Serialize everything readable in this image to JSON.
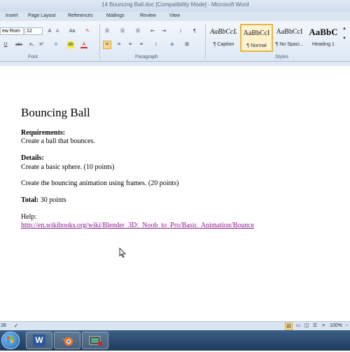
{
  "window": {
    "title": "14 Bouncing Ball.doc [Compatibility Mode] - Microsoft Word"
  },
  "tabs": [
    "Insert",
    "Page Layout",
    "References",
    "Mailings",
    "Review",
    "View"
  ],
  "ribbon": {
    "font_name": "ew Rom",
    "font_size": "12",
    "group_font": "Font",
    "group_paragraph": "Paragraph",
    "group_styles": "Styles",
    "styles": [
      {
        "sample": "AaBbCcL",
        "name": "¶ Caption"
      },
      {
        "sample": "AaBbCcI",
        "name": "¶ Normal"
      },
      {
        "sample": "AaBbCcI",
        "name": "¶ No Spaci..."
      },
      {
        "sample": "AaBbC",
        "name": "Heading 1"
      }
    ]
  },
  "document": {
    "title": "Bouncing Ball",
    "requirements_label": "Requirements:",
    "requirements_text": "Create a ball that bounces.",
    "details_label": "Details:",
    "detail_1": "Create a basic sphere.  (10 points)",
    "detail_2": "Create the bouncing animation using frames.  (20 points)",
    "total_label": "Total:",
    "total_value": " 30 points",
    "help_label": "Help:",
    "help_link": "http://en.wikibooks.org/wiki/Blender_3D:_Noob_to_Pro/Basic_Animation/Bounce"
  },
  "status": {
    "words": "28",
    "zoom": "100%"
  },
  "colors": {
    "link": "#8b1a8b",
    "selected_style_border": "#e3b64c",
    "taskbar": "#2a4a6f"
  }
}
